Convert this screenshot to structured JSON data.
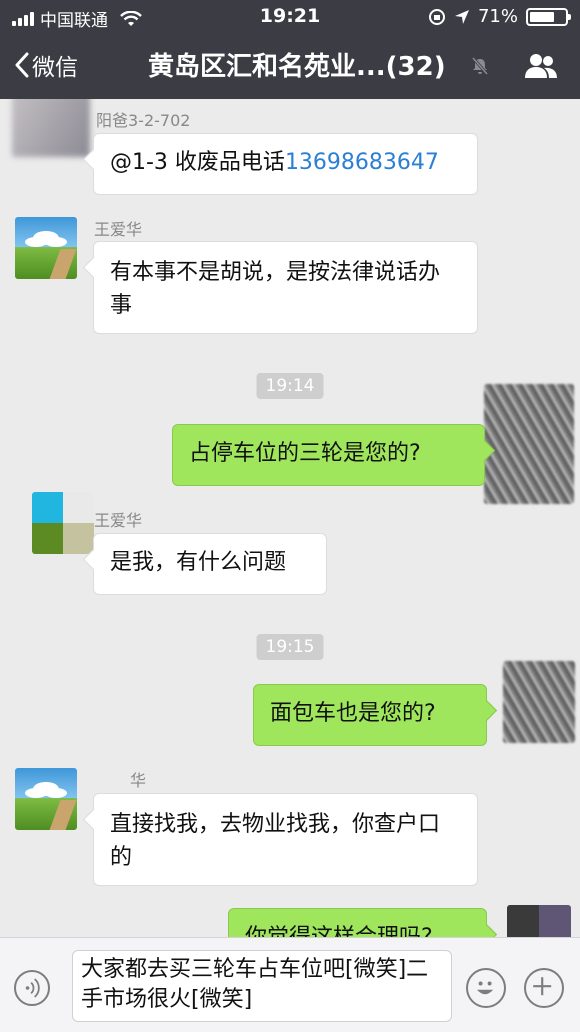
{
  "status_bar": {
    "carrier": "中国联通",
    "time": "19:21",
    "battery": "71%",
    "battery_level": 0.71
  },
  "nav": {
    "back_label": "微信",
    "title": "黄岛区汇和名苑业...(32)"
  },
  "messages": [
    {
      "side": "left",
      "sender": "阳爸3-2-702",
      "text_prefix": "@1-3 收废品电话",
      "text_link": "13698683647"
    },
    {
      "side": "left",
      "sender": "王爱华",
      "text": "有本事不是胡说，是按法律说话办事"
    },
    {
      "type": "timestamp",
      "text": "19:14"
    },
    {
      "side": "right",
      "text": "占停车位的三轮是您的?"
    },
    {
      "side": "left",
      "sender": "王爱华",
      "text": "是我，有什么问题"
    },
    {
      "type": "timestamp",
      "text": "19:15"
    },
    {
      "side": "right",
      "text": "面包车也是您的?"
    },
    {
      "side": "left",
      "sender": "华",
      "text": "直接找我，去物业找我，你查户口的"
    },
    {
      "side": "right",
      "text": "你觉得这样合理吗?"
    }
  ],
  "input": {
    "text": "大家都去买三轮车占车位吧[微笑]二手市场很火[微笑]"
  },
  "icons": {
    "back": "chevron-left-icon",
    "mute": "mute-icon",
    "group": "group-members-icon",
    "voice": "voice-icon",
    "emoji": "emoji-icon",
    "more": "plus-icon"
  },
  "colors": {
    "header_bg": "#3c3c44",
    "chat_bg": "#ebebeb",
    "sent_bubble": "#9fe65c",
    "received_bubble": "#ffffff",
    "link": "#2b7fd4"
  }
}
